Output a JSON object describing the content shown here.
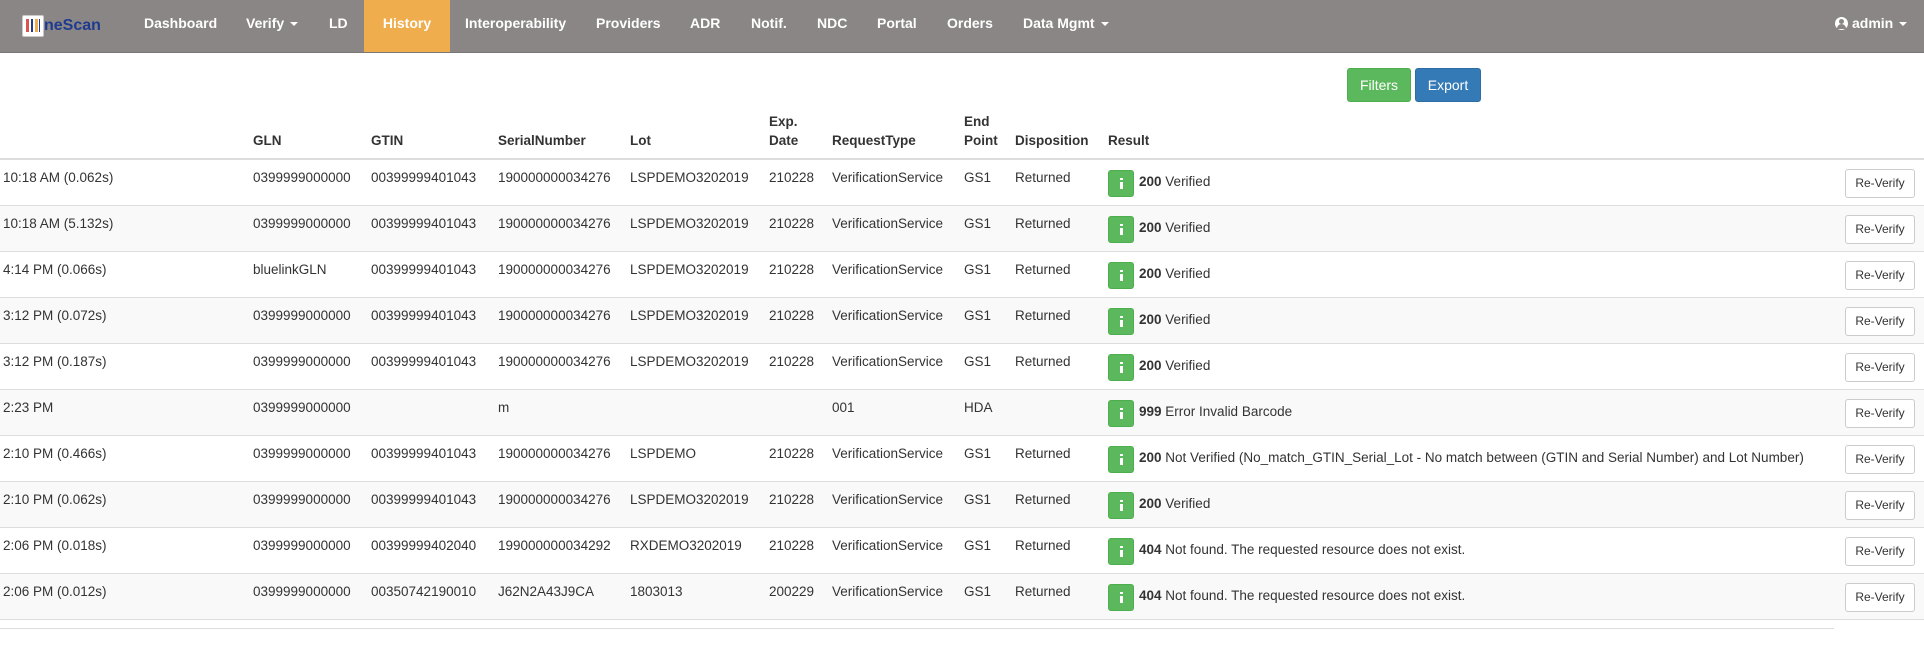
{
  "brand": {
    "name": "neScan"
  },
  "nav": {
    "items": [
      {
        "label": "Dashboard"
      },
      {
        "label": "Verify"
      },
      {
        "label": "LD"
      },
      {
        "label": "History"
      },
      {
        "label": "Interoperability"
      },
      {
        "label": "Providers"
      },
      {
        "label": "ADR"
      },
      {
        "label": "Notif."
      },
      {
        "label": "NDC"
      },
      {
        "label": "Portal"
      },
      {
        "label": "Orders"
      },
      {
        "label": "Data Mgmt"
      }
    ],
    "user": "admin",
    "active_color": "#f0ad4e",
    "bar_color": "#8a8686"
  },
  "toolbar": {
    "filters_label": "Filters",
    "export_label": "Export"
  },
  "table": {
    "headers": {
      "gln": "GLN",
      "gtin": "GTIN",
      "serial": "SerialNumber",
      "lot": "Lot",
      "exp_line1": "Exp.",
      "exp_line2": "Date",
      "request_type": "RequestType",
      "endpoint_line1": "End",
      "endpoint_line2": "Point",
      "disposition": "Disposition",
      "result": "Result"
    },
    "reverify_label": "Re-Verify",
    "rows": [
      {
        "time": "10:18 AM (0.062s)",
        "gln": "0399999000000",
        "gtin": "00399999401043",
        "serial": "190000000034276",
        "lot": "LSPDEMO3202019",
        "exp": "210228",
        "request_type": "VerificationService",
        "endpoint": "GS1",
        "disposition": "Returned",
        "code": "200",
        "message": "Verified"
      },
      {
        "time": "10:18 AM (5.132s)",
        "gln": "0399999000000",
        "gtin": "00399999401043",
        "serial": "190000000034276",
        "lot": "LSPDEMO3202019",
        "exp": "210228",
        "request_type": "VerificationService",
        "endpoint": "GS1",
        "disposition": "Returned",
        "code": "200",
        "message": "Verified"
      },
      {
        "time": "4:14 PM (0.066s)",
        "gln": "bluelinkGLN",
        "gtin": "00399999401043",
        "serial": "190000000034276",
        "lot": "LSPDEMO3202019",
        "exp": "210228",
        "request_type": "VerificationService",
        "endpoint": "GS1",
        "disposition": "Returned",
        "code": "200",
        "message": "Verified"
      },
      {
        "time": "3:12 PM (0.072s)",
        "gln": "0399999000000",
        "gtin": "00399999401043",
        "serial": "190000000034276",
        "lot": "LSPDEMO3202019",
        "exp": "210228",
        "request_type": "VerificationService",
        "endpoint": "GS1",
        "disposition": "Returned",
        "code": "200",
        "message": "Verified"
      },
      {
        "time": "3:12 PM (0.187s)",
        "gln": "0399999000000",
        "gtin": "00399999401043",
        "serial": "190000000034276",
        "lot": "LSPDEMO3202019",
        "exp": "210228",
        "request_type": "VerificationService",
        "endpoint": "GS1",
        "disposition": "Returned",
        "code": "200",
        "message": "Verified"
      },
      {
        "time": "2:23 PM",
        "gln": "0399999000000",
        "gtin": "",
        "serial": "m",
        "lot": "",
        "exp": "",
        "request_type": "001",
        "endpoint": "HDA",
        "disposition": "",
        "code": "999",
        "message": "Error Invalid Barcode"
      },
      {
        "time": "2:10 PM (0.466s)",
        "gln": "0399999000000",
        "gtin": "00399999401043",
        "serial": "190000000034276",
        "lot": "LSPDEMO",
        "exp": "210228",
        "request_type": "VerificationService",
        "endpoint": "GS1",
        "disposition": "Returned",
        "code": "200",
        "message": "Not Verified (No_match_GTIN_Serial_Lot - No match between (GTIN and Serial Number) and Lot Number)"
      },
      {
        "time": "2:10 PM (0.062s)",
        "gln": "0399999000000",
        "gtin": "00399999401043",
        "serial": "190000000034276",
        "lot": "LSPDEMO3202019",
        "exp": "210228",
        "request_type": "VerificationService",
        "endpoint": "GS1",
        "disposition": "Returned",
        "code": "200",
        "message": "Verified"
      },
      {
        "time": "2:06 PM (0.018s)",
        "gln": "0399999000000",
        "gtin": "00399999402040",
        "serial": "199000000034292",
        "lot": "RXDEMO3202019",
        "exp": "210228",
        "request_type": "VerificationService",
        "endpoint": "GS1",
        "disposition": "Returned",
        "code": "404",
        "message": "Not found. The requested resource does not exist."
      },
      {
        "time": "2:06 PM (0.012s)",
        "gln": "0399999000000",
        "gtin": "00350742190010",
        "serial": "J62N2A43J9CA",
        "lot": "1803013",
        "exp": "200229",
        "request_type": "VerificationService",
        "endpoint": "GS1",
        "disposition": "Returned",
        "code": "404",
        "message": "Not found. The requested resource does not exist."
      }
    ]
  }
}
